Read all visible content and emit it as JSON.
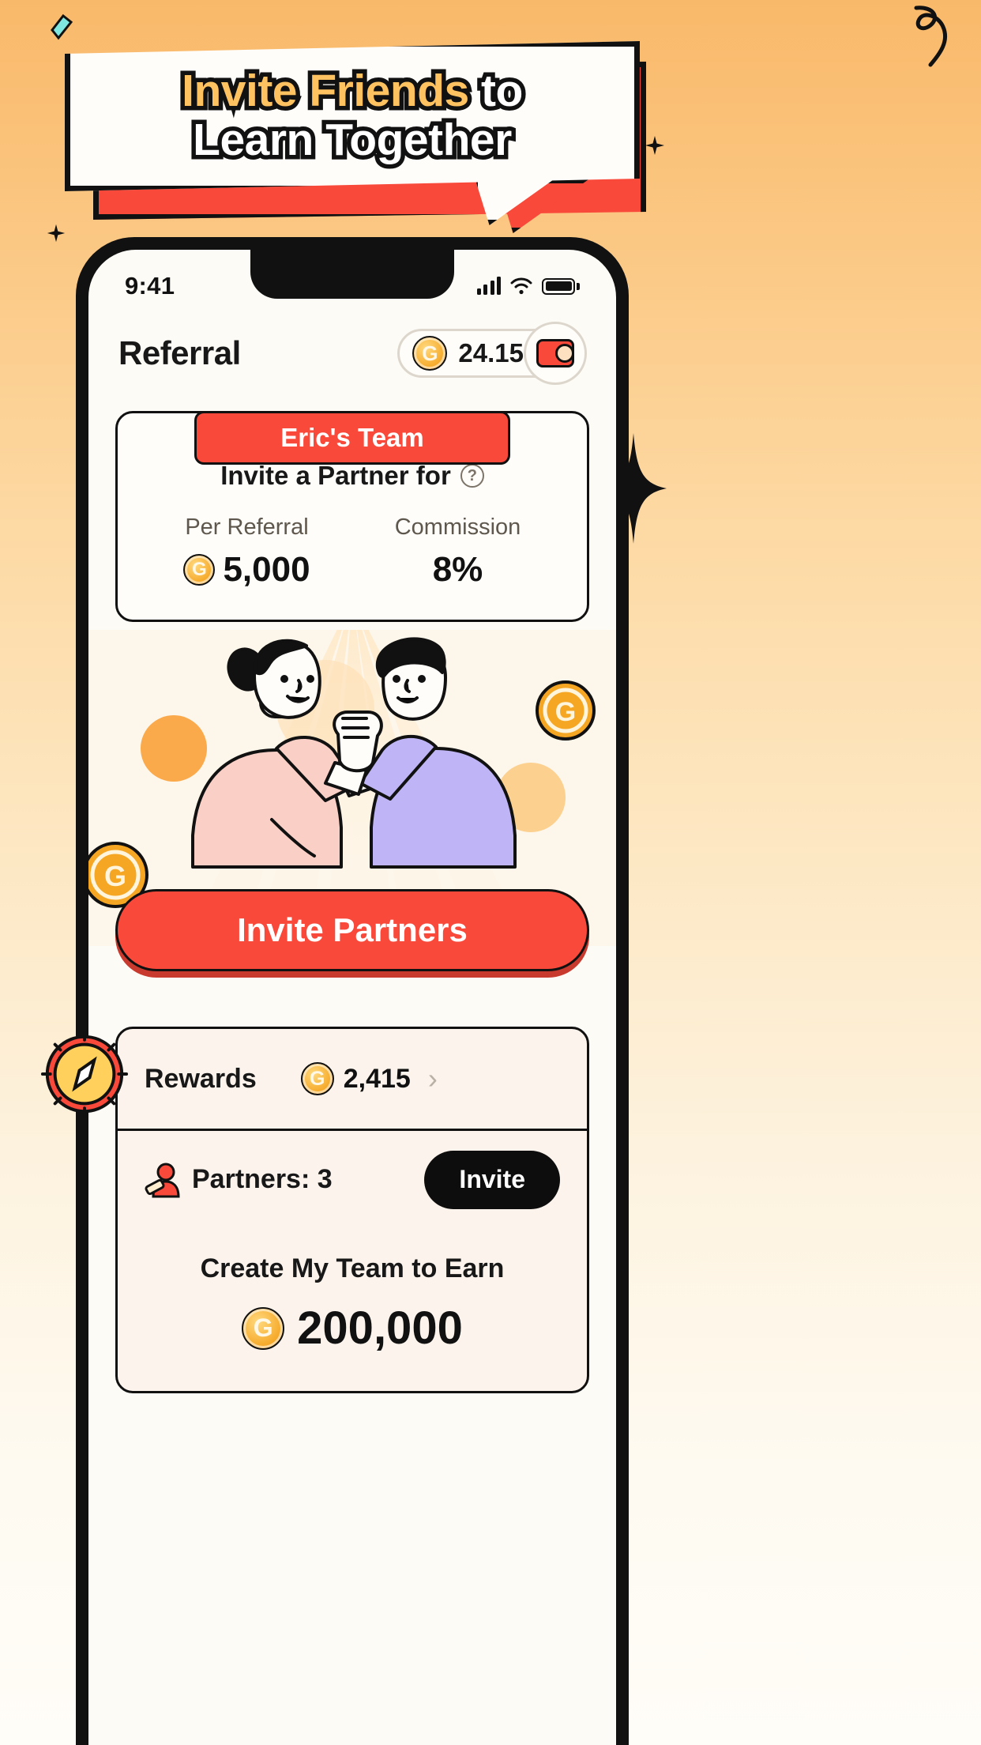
{
  "banner": {
    "line1_highlight": "Invite Friends",
    "line1_rest": " to",
    "line2": "Learn Together"
  },
  "phone": {
    "status": {
      "time": "9:41",
      "signal_icon": "signal-bars-icon",
      "wifi_icon": "wifi-icon",
      "battery_icon": "battery-icon"
    },
    "header": {
      "title": "Referral",
      "balance": "24.15",
      "coin_glyph": "G",
      "wallet_icon": "wallet-icon"
    },
    "team_card": {
      "tab_label": "Eric's Team",
      "subtitle": "Invite a Partner for",
      "help_icon": "question-mark-icon",
      "stats": [
        {
          "label": "Per Referral",
          "value": "5,000",
          "has_coin": true
        },
        {
          "label": "Commission",
          "value": "8%",
          "has_coin": false
        }
      ]
    },
    "cta": {
      "label": "Invite Partners"
    },
    "list": {
      "rewards": {
        "label": "Rewards",
        "value": "2,415",
        "chevron": "›"
      },
      "partners": {
        "label": "Partners: 3",
        "icon": "partners-icon",
        "button": "Invite"
      },
      "earn": {
        "title": "Create My Team to Earn",
        "value": "200,000"
      }
    }
  },
  "colors": {
    "accent_red": "#f9493a",
    "coin_gold": "#f5a623",
    "banner_highlight": "#ffc260",
    "ink": "#111111"
  }
}
